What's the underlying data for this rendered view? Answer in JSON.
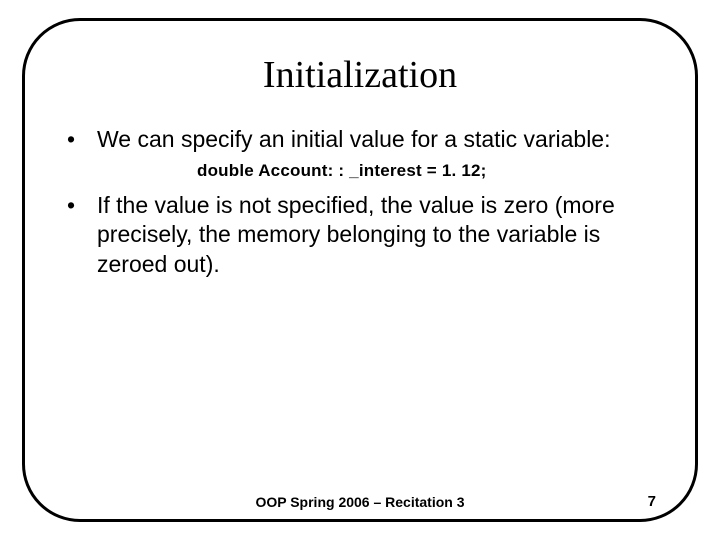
{
  "slide": {
    "title": "Initialization",
    "bullets": [
      {
        "text": "We can specify an initial value for a static variable:"
      },
      {
        "text": "If the value is not specified, the value is zero (more precisely, the memory belonging to the variable is zeroed out)."
      }
    ],
    "code": "double Account: : _interest = 1. 12;",
    "footer": "OOP Spring 2006 – Recitation 3",
    "page": "7",
    "bullet_char": "•"
  }
}
